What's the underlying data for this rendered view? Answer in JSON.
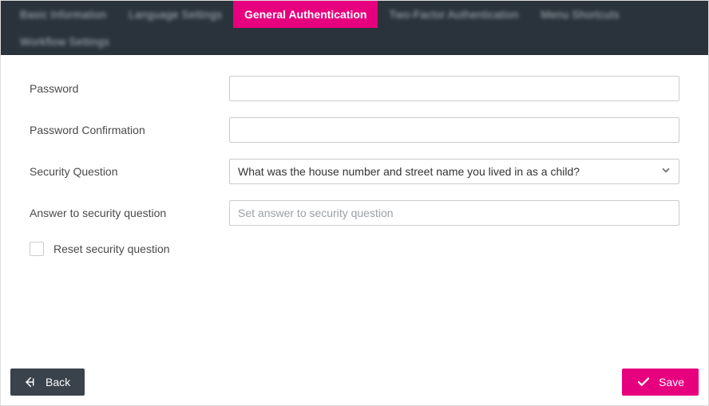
{
  "tabs": {
    "items": [
      {
        "label": "Basic Information",
        "active": false,
        "blurred": true
      },
      {
        "label": "Language Settings",
        "active": false,
        "blurred": true
      },
      {
        "label": "General Authentication",
        "active": true,
        "blurred": false
      },
      {
        "label": "Two-Factor Authentication",
        "active": false,
        "blurred": true
      },
      {
        "label": "Menu Shortcuts",
        "active": false,
        "blurred": true
      },
      {
        "label": "Workflow Settings",
        "active": false,
        "blurred": true
      }
    ]
  },
  "form": {
    "password_label": "Password",
    "password_value": "",
    "password_confirm_label": "Password Confirmation",
    "password_confirm_value": "",
    "security_question_label": "Security Question",
    "security_question_value": "What was the house number and street name you lived in as a child?",
    "answer_label": "Answer to security question",
    "answer_value": "",
    "answer_placeholder": "Set answer to security question",
    "reset_label": "Reset security question",
    "reset_checked": false
  },
  "footer": {
    "back_label": "Back",
    "save_label": "Save"
  },
  "colors": {
    "accent": "#e6007e",
    "tabbar": "#2a333c",
    "btn_dark": "#3a424b"
  }
}
